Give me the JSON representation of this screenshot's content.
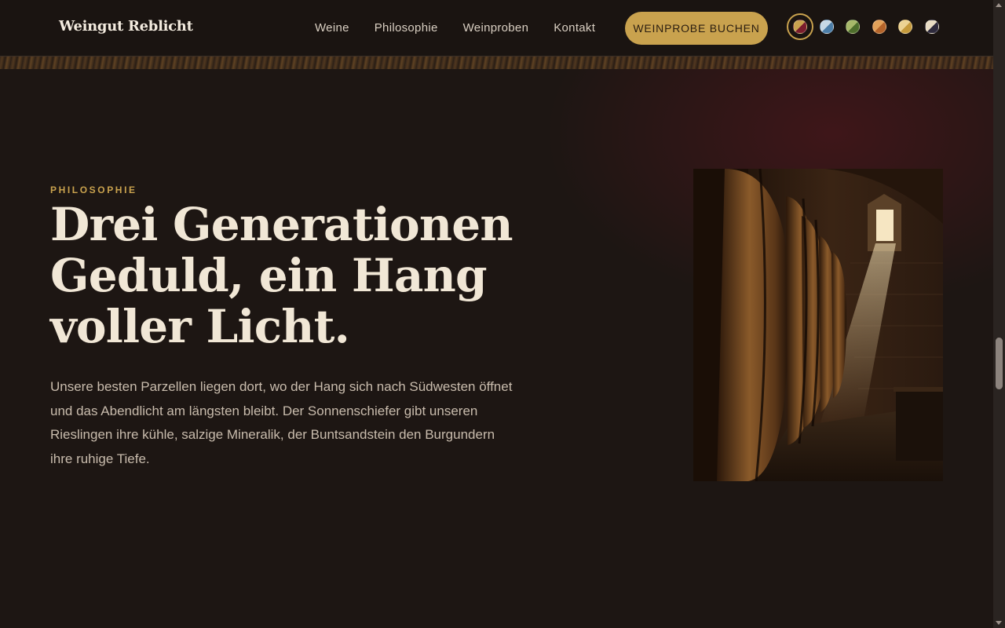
{
  "header": {
    "logo": "Weingut Reblicht",
    "nav": [
      {
        "label": "Weine"
      },
      {
        "label": "Philosophie"
      },
      {
        "label": "Weinproben"
      },
      {
        "label": "Kontakt"
      }
    ],
    "cta_label": "WEINPROBE BUCHEN",
    "theme_swatches": [
      {
        "name": "bordeaux",
        "c1": "#7a1c2c",
        "c2": "#c9a24e",
        "active": true
      },
      {
        "name": "blue",
        "c1": "#4c7ea8",
        "c2": "#c7d9e6",
        "active": false
      },
      {
        "name": "green",
        "c1": "#4e6e2c",
        "c2": "#a7b86a",
        "active": false
      },
      {
        "name": "orange",
        "c1": "#b5642a",
        "c2": "#e3a25a",
        "active": false
      },
      {
        "name": "gold",
        "c1": "#c59a3c",
        "c2": "#ecd394",
        "active": false
      },
      {
        "name": "night",
        "c1": "#2e2a3c",
        "c2": "#e8dcc4",
        "active": false
      }
    ]
  },
  "section": {
    "eyebrow": "PHILOSOPHIE",
    "headline_line1": "Drei Generationen",
    "headline_line2": "Geduld, ein Hang",
    "headline_line3": "voller Licht.",
    "body": "Unsere besten Parzellen liegen dort, wo der Hang sich nach Südwesten öffnet und das Abendlicht am längsten bleibt. Der Sonnenschiefer gibt unseren Rieslingen ihre kühle, salzige Mineralik, der Buntsandstein den Burgundern ihre ruhige Tiefe."
  },
  "colors": {
    "accent": "#c9a24e",
    "background": "#1d1613",
    "header_bg": "#1a1411",
    "text": "#f1e7d6"
  }
}
